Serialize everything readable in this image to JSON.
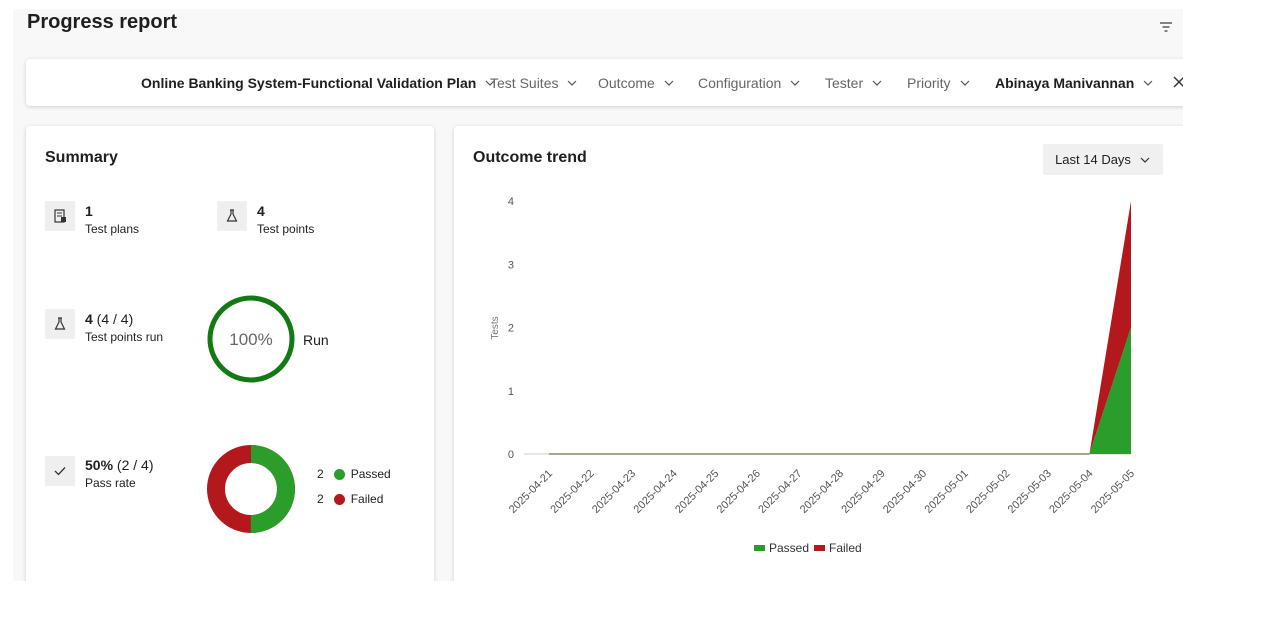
{
  "header": {
    "title": "Progress report"
  },
  "filters": {
    "plan": "Online Banking System-Functional Validation Plan",
    "test_suites": "Test Suites",
    "outcome": "Outcome",
    "configuration": "Configuration",
    "tester": "Tester",
    "priority": "Priority",
    "user": "Abinaya Manivannan"
  },
  "summary": {
    "title": "Summary",
    "test_plans": {
      "value": "1",
      "label": "Test plans"
    },
    "test_points": {
      "value": "4",
      "label": "Test points"
    },
    "points_run": {
      "value": "4",
      "detail": " (4 / 4)",
      "label": "Test points run",
      "percent": "100%",
      "run_label": "Run",
      "run_fraction": 1.0
    },
    "pass_rate": {
      "value": "50%",
      "detail": " (2 / 4)",
      "label": "Pass rate",
      "passed_count": "2",
      "passed_label": "Passed",
      "failed_count": "2",
      "failed_label": "Failed"
    }
  },
  "trend": {
    "title": "Outcome trend",
    "range": "Last 14 Days"
  },
  "colors": {
    "passed": "#2a9d2a",
    "failed": "#b3191c",
    "run_ring": "#137a13",
    "axis_flat": "#8a8a6a"
  },
  "chart_data": {
    "type": "area",
    "stacked": true,
    "ylabel": "Tests",
    "ylim": [
      0,
      4
    ],
    "yticks": [
      "0",
      "1",
      "2",
      "3",
      "4"
    ],
    "x": [
      "2025-04-21",
      "2025-04-22",
      "2025-04-23",
      "2025-04-24",
      "2025-04-25",
      "2025-04-26",
      "2025-04-27",
      "2025-04-28",
      "2025-04-29",
      "2025-04-30",
      "2025-05-01",
      "2025-05-02",
      "2025-05-03",
      "2025-05-04",
      "2025-05-05"
    ],
    "series": [
      {
        "name": "Passed",
        "color": "#2a9d2a",
        "values": [
          0,
          0,
          0,
          0,
          0,
          0,
          0,
          0,
          0,
          0,
          0,
          0,
          0,
          0,
          2
        ]
      },
      {
        "name": "Failed",
        "color": "#b3191c",
        "values": [
          0,
          0,
          0,
          0,
          0,
          0,
          0,
          0,
          0,
          0,
          0,
          0,
          0,
          0,
          2
        ]
      }
    ],
    "legend": "bottom"
  }
}
